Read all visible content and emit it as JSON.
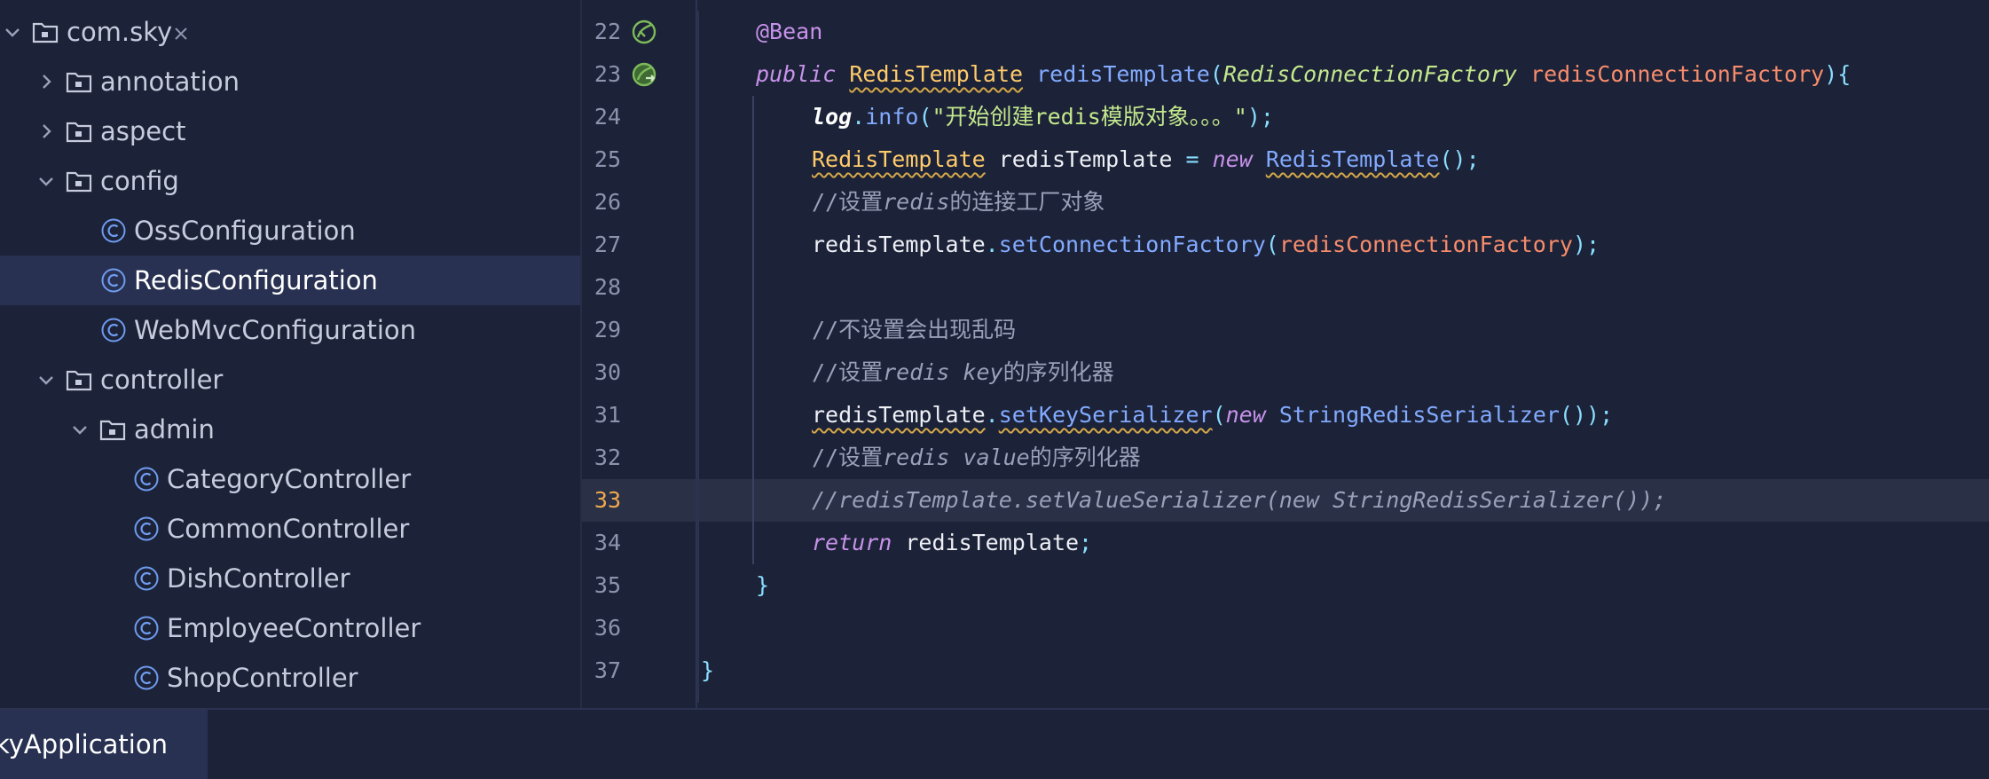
{
  "colors": {
    "background": "#1c2237",
    "selected_row": "#283151",
    "current_line": "#2a3147",
    "keyword": "#c792ea",
    "type": "#ffcb6b",
    "function": "#82aaff",
    "string": "#c3e88d",
    "parameter": "#f78c6c",
    "comment": "#9aa0b8",
    "current_line_number": "#f0a94e"
  },
  "sidebar": {
    "items": [
      {
        "label": "com.sky",
        "icon": "folder-icon",
        "expanded": true
      },
      {
        "label": "annotation",
        "icon": "folder-icon",
        "expanded": false
      },
      {
        "label": "aspect",
        "icon": "folder-icon",
        "expanded": false
      },
      {
        "label": "config",
        "icon": "folder-icon",
        "expanded": true
      },
      {
        "label": "OssConfiguration",
        "icon": "class-icon"
      },
      {
        "label": "RedisConfiguration",
        "icon": "class-icon",
        "selected": true
      },
      {
        "label": "WebMvcConfiguration",
        "icon": "class-icon"
      },
      {
        "label": "controller",
        "icon": "folder-icon",
        "expanded": true
      },
      {
        "label": "admin",
        "icon": "folder-icon",
        "expanded": true
      },
      {
        "label": "CategoryController",
        "icon": "class-icon"
      },
      {
        "label": "CommonController",
        "icon": "class-icon"
      },
      {
        "label": "DishController",
        "icon": "class-icon"
      },
      {
        "label": "EmployeeController",
        "icon": "class-icon"
      },
      {
        "label": "ShopController",
        "icon": "class-icon"
      }
    ]
  },
  "editor": {
    "current_line": "33",
    "line_numbers": [
      "22",
      "23",
      "24",
      "25",
      "26",
      "27",
      "28",
      "29",
      "30",
      "31",
      "32",
      "33",
      "34",
      "35",
      "36",
      "37"
    ],
    "gutter_icons": {
      "22": "bean-icon",
      "23": "bean-method-icon"
    },
    "tokens": {
      "l22_ann": "@Bean",
      "l23_public": "public",
      "l23_type": "RedisTemplate",
      "l23_method": "redisTemplate",
      "l23_paren_open": "(",
      "l23_param_type": "RedisConnectionFactory",
      "l23_param": "redisConnectionFactory",
      "l23_paren_close": "){",
      "l24_log": "log",
      "l24_dot": ".",
      "l24_info": "info",
      "l24_paren_open": "(",
      "l24_string": "\"开始创建redis模版对象。。。\"",
      "l24_end": ");",
      "l25_type": "RedisTemplate",
      "l25_var": "redisTemplate",
      "l25_eq": "=",
      "l25_new": "new",
      "l25_ctor": "RedisTemplate",
      "l25_end": "();",
      "l26_prefix": "//设置",
      "l26_it": "redis",
      "l26_suffix": "的连接工厂对象",
      "l27_var": "redisTemplate",
      "l27_dot": ".",
      "l27_method": "setConnectionFactory",
      "l27_paren_open": "(",
      "l27_param": "redisConnectionFactory",
      "l27_end": ");",
      "l29_comment": "//不设置会出现乱码",
      "l30_prefix": "//设置",
      "l30_it": "redis key",
      "l30_suffix": "的序列化器",
      "l31_var": "redisTemplate",
      "l31_dot": ".",
      "l31_method": "setKeySerializer",
      "l31_paren_open": "(",
      "l31_new": "new",
      "l31_ctor": "StringRedisSerializer",
      "l31_end": "());",
      "l32_prefix": "//设置",
      "l32_it": "redis value",
      "l32_suffix": "的序列化器",
      "l33_comment": "//redisTemplate.setValueSerializer(new StringRedisSerializer());",
      "l34_return": "return",
      "l34_var": "redisTemplate",
      "l34_end": ";",
      "l35_brace": "}",
      "l37_brace": "}"
    }
  },
  "bottom_tab": {
    "label": "kyApplication",
    "close": "×"
  }
}
